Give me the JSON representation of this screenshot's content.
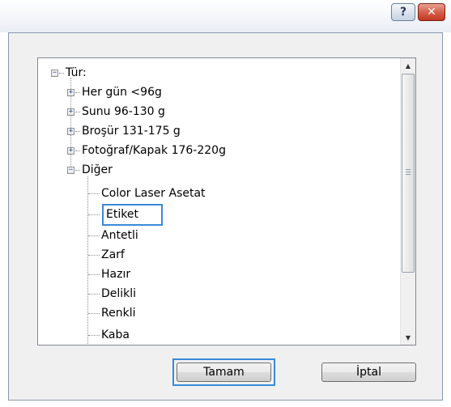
{
  "window": {
    "help_label": "?",
    "close_label": "✕"
  },
  "tree": {
    "root_label": "Tür:",
    "items": [
      {
        "label": "Her gün <96g"
      },
      {
        "label": "Sunu 96-130 g"
      },
      {
        "label": "Broşür 131-175 g"
      },
      {
        "label": "Fotoğraf/Kapak 176-220g"
      },
      {
        "label": "Diğer"
      }
    ],
    "children": [
      {
        "label": "Color Laser Asetat"
      },
      {
        "label": "Etiket"
      },
      {
        "label": "Antetli"
      },
      {
        "label": "Zarf"
      },
      {
        "label": "Hazır"
      },
      {
        "label": "Delikli"
      },
      {
        "label": "Renkli"
      },
      {
        "label": "Kaba"
      }
    ],
    "selected": "Etiket"
  },
  "buttons": {
    "ok_label": "Tamam",
    "cancel_label": "İptal"
  },
  "colors": {
    "selection_border": "#3a8ad8",
    "close_button": "#c43a22"
  }
}
